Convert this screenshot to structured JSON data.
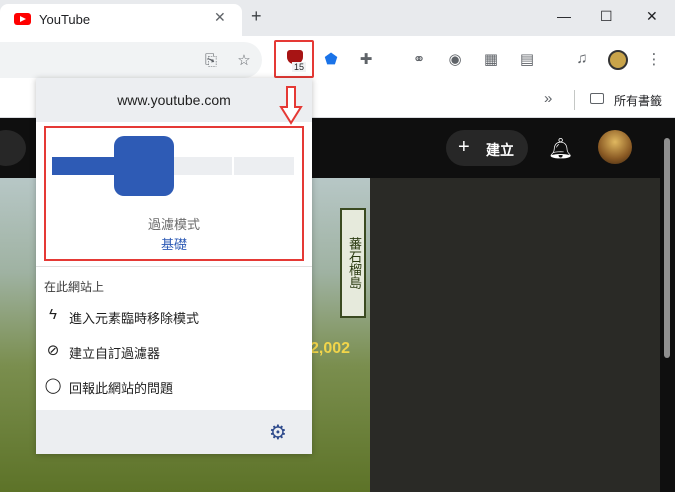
{
  "browser": {
    "tab_title": "YouTube",
    "tab_close": "✕",
    "new_tab": "+",
    "window_controls": [
      "—",
      "☐",
      "✕"
    ],
    "bookmarks_overflow": "»",
    "all_bookmarks": "所有書籤",
    "extension_badge": "15"
  },
  "youtube": {
    "create_label": "建立",
    "artwork_text": "蕃石榴島",
    "score_text": "2,002"
  },
  "popup": {
    "domain": "www.youtube.com",
    "filter_mode_label": "過濾模式",
    "filter_mode_value": "基礎",
    "filter_level": 2,
    "filter_levels_total": 4,
    "section_title": "在此網站上",
    "items": [
      {
        "label": "進入元素臨時移除模式",
        "icon": "lightning-icon"
      },
      {
        "label": "建立自訂過濾器",
        "icon": "eye-slash-icon"
      },
      {
        "label": "回報此網站的問題",
        "icon": "chat-bubble-icon"
      }
    ],
    "accent_color": "#2e5bb5",
    "highlight_color": "#e53935"
  }
}
